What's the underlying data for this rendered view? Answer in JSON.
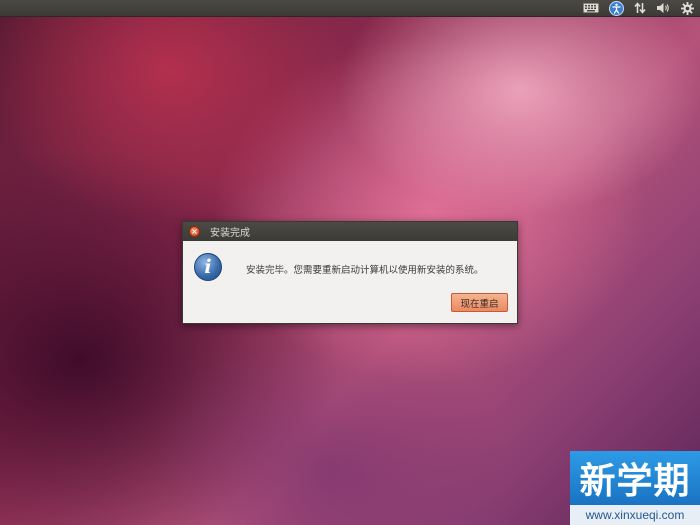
{
  "panel": {
    "indicators": [
      "keyboard-icon",
      "accessibility-icon",
      "network-icon",
      "volume-icon",
      "session-gear-icon"
    ]
  },
  "dialog": {
    "title": "安装完成",
    "message": "安装完毕。您需要重新启动计算机以使用新安装的系统。",
    "icon": "info-icon",
    "button_label": "现在重启",
    "info_glyph": "i",
    "close_glyph": "×"
  },
  "watermark": {
    "logo_text": "新学期",
    "url": "www.xinxueqi.com"
  },
  "colors": {
    "accent_button": "#ea8a63",
    "close_button": "#d2461d",
    "panel": "#3c3b37",
    "watermark_blue": "#1a73c2"
  }
}
